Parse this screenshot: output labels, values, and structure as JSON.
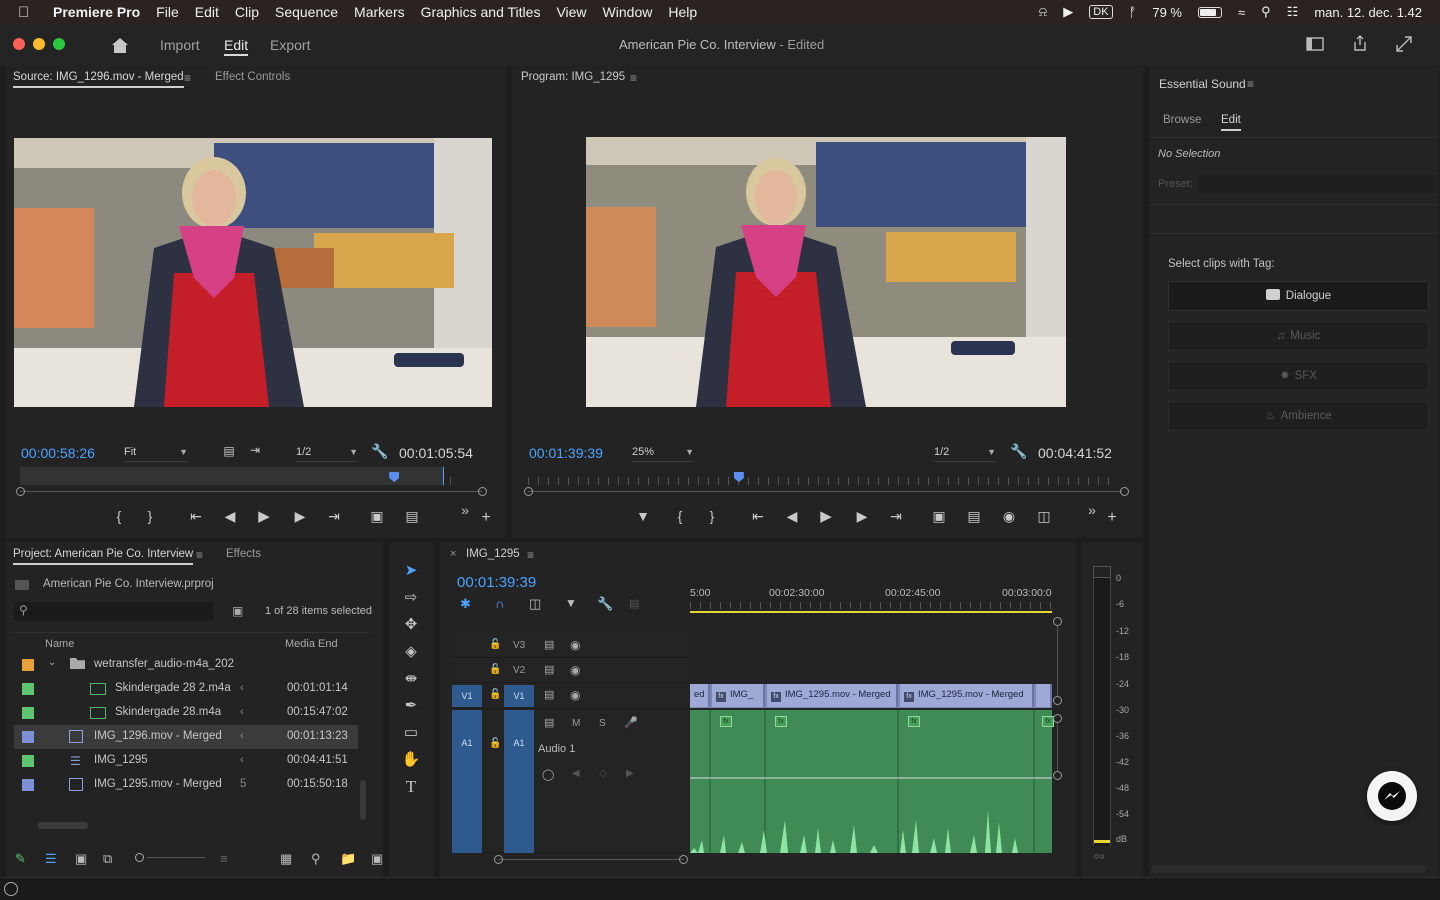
{
  "menubar": {
    "app": "Premiere Pro",
    "items": [
      "File",
      "Edit",
      "Clip",
      "Sequence",
      "Markers",
      "Graphics and Titles",
      "View",
      "Window",
      "Help"
    ],
    "keyboard": "DK",
    "battery": "79 %",
    "datetime": "man. 12. dec. 1.42"
  },
  "titlebar": {
    "nav": [
      "Import",
      "Edit",
      "Export"
    ],
    "active": "Edit",
    "project_title": "American Pie Co. Interview",
    "status": " - Edited"
  },
  "source": {
    "tab": "Source: IMG_1296.mov - Merged",
    "tab2": "Effect Controls",
    "timecode": "00:00:58:26",
    "zoom": "Fit",
    "resolution": "1/2",
    "duration": "00:01:05:54",
    "playhead_fraction": 0.81
  },
  "program": {
    "tab": "Program: IMG_1295",
    "timecode": "00:01:39:39",
    "zoom": "25%",
    "resolution": "1/2",
    "duration": "00:04:41:52",
    "playhead_fraction": 0.355
  },
  "project": {
    "tab": "Project: American Pie Co. Interview",
    "tab2": "Effects",
    "file": "American Pie Co. Interview.prproj",
    "selection": "1 of 28 items selected",
    "col_name": "Name",
    "col_end": "Media End",
    "rows": [
      {
        "name": "wetransfer_audio-m4a_202",
        "end": "",
        "color": "#e8a23a",
        "sep": ""
      },
      {
        "name": "Skindergade 28 2.m4a",
        "end": "00:01:01:14",
        "color": "#5fc46f",
        "sep": "‹"
      },
      {
        "name": "Skindergade 28.m4a",
        "end": "00:15:47:02",
        "color": "#5fc46f",
        "sep": "‹"
      },
      {
        "name": "IMG_1296.mov - Merged",
        "end": "00:01:13:23",
        "color": "#7d8fd6",
        "sep": "‹"
      },
      {
        "name": "IMG_1295",
        "end": "00:04:41:51",
        "color": "#5fc46f",
        "sep": "‹"
      },
      {
        "name": "IMG_1295.mov - Merged",
        "end": "00:15:50:18",
        "color": "#7d8fd6",
        "sep": "5"
      }
    ]
  },
  "timeline": {
    "tab": "IMG_1295",
    "timecode": "00:01:39:39",
    "ruler": [
      "5:00",
      "00:02:30:00",
      "00:02:45:00",
      "00:03:00:0"
    ],
    "tracks": {
      "v3": "V3",
      "v2": "V2",
      "v1": "V1",
      "a1": "A1",
      "target_v": "V1",
      "target_a": "A1",
      "m": "M",
      "s": "S"
    },
    "audio_name": "Audio 1",
    "clips": [
      "ed",
      "IMG_",
      "IMG_1295.mov - Merged",
      "IMG_1295.mov - Merged"
    ]
  },
  "meter": {
    "labels": [
      "0",
      "-6",
      "-12",
      "-18",
      "-24",
      "-30",
      "-36",
      "-42",
      "-48",
      "-54",
      "dB"
    ]
  },
  "essential_sound": {
    "title": "Essential Sound",
    "tabs": [
      "Browse",
      "Edit"
    ],
    "active": "Edit",
    "no_selection": "No Selection",
    "preset_label": "Preset:",
    "select_label": "Select clips with Tag:",
    "buttons": [
      "Dialogue",
      "Music",
      "SFX",
      "Ambience"
    ]
  },
  "colors": {
    "accent_blue": "#4da3ff",
    "selection_yellow": "#e5d633",
    "video_clip": "#9ea9d6",
    "audio_clip": "#3f8a55"
  }
}
